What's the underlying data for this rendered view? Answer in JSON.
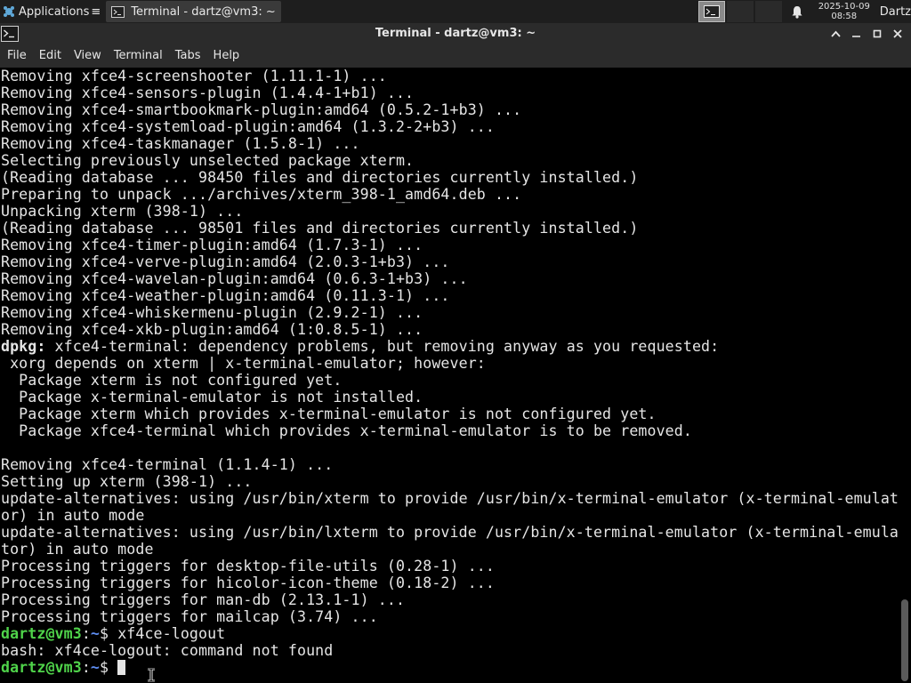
{
  "panel": {
    "apps_label": "Applications",
    "task_label": "Terminal - dartz@vm3: ~",
    "clock_date": "2025-10-09",
    "clock_time": "08:58",
    "user": "Dartz"
  },
  "window": {
    "title": "Terminal - dartz@vm3: ~"
  },
  "menu": [
    "File",
    "Edit",
    "View",
    "Terminal",
    "Tabs",
    "Help"
  ],
  "terminal": {
    "lines": [
      {
        "text": "Removing xfce4-screenshooter (1.11.1-1) ..."
      },
      {
        "text": "Removing xfce4-sensors-plugin (1.4.4-1+b1) ..."
      },
      {
        "text": "Removing xfce4-smartbookmark-plugin:amd64 (0.5.2-1+b3) ..."
      },
      {
        "text": "Removing xfce4-systemload-plugin:amd64 (1.3.2-2+b3) ..."
      },
      {
        "text": "Removing xfce4-taskmanager (1.5.8-1) ..."
      },
      {
        "text": "Selecting previously unselected package xterm."
      },
      {
        "text": "(Reading database ... 98450 files and directories currently installed.)"
      },
      {
        "text": "Preparing to unpack .../archives/xterm_398-1_amd64.deb ..."
      },
      {
        "text": "Unpacking xterm (398-1) ..."
      },
      {
        "text": "(Reading database ... 98501 files and directories currently installed.)"
      },
      {
        "text": "Removing xfce4-timer-plugin:amd64 (1.7.3-1) ..."
      },
      {
        "text": "Removing xfce4-verve-plugin:amd64 (2.0.3-1+b3) ..."
      },
      {
        "text": "Removing xfce4-wavelan-plugin:amd64 (0.6.3-1+b3) ..."
      },
      {
        "text": "Removing xfce4-weather-plugin:amd64 (0.11.3-1) ..."
      },
      {
        "text": "Removing xfce4-whiskermenu-plugin (2.9.2-1) ..."
      },
      {
        "text": "Removing xfce4-xkb-plugin:amd64 (1:0.8.5-1) ..."
      },
      {
        "bold": "dpkg:",
        "text": " xfce4-terminal: dependency problems, but removing anyway as you requested:"
      },
      {
        "text": " xorg depends on xterm | x-terminal-emulator; however:"
      },
      {
        "text": "  Package xterm is not configured yet."
      },
      {
        "text": "  Package x-terminal-emulator is not installed."
      },
      {
        "text": "  Package xterm which provides x-terminal-emulator is not configured yet."
      },
      {
        "text": "  Package xfce4-terminal which provides x-terminal-emulator is to be removed."
      },
      {
        "text": ""
      },
      {
        "text": "Removing xfce4-terminal (1.1.4-1) ..."
      },
      {
        "text": "Setting up xterm (398-1) ..."
      },
      {
        "text": "update-alternatives: using /usr/bin/xterm to provide /usr/bin/x-terminal-emulator (x-terminal-emulat"
      },
      {
        "text": "or) in auto mode"
      },
      {
        "text": "update-alternatives: using /usr/bin/lxterm to provide /usr/bin/x-terminal-emulator (x-terminal-emula"
      },
      {
        "text": "tor) in auto mode"
      },
      {
        "text": "Processing triggers for desktop-file-utils (0.28-1) ..."
      },
      {
        "text": "Processing triggers for hicolor-icon-theme (0.18-2) ..."
      },
      {
        "text": "Processing triggers for man-db (2.13.1-1) ..."
      },
      {
        "text": "Processing triggers for mailcap (3.74) ..."
      },
      {
        "prompt_user": "dartz@vm3",
        "prompt_sep": ":",
        "prompt_path": "~",
        "prompt_sign": "$ ",
        "text": "xf4ce-logout"
      },
      {
        "text": "bash: xf4ce-logout: command not found"
      },
      {
        "prompt_user": "dartz@vm3",
        "prompt_sep": ":",
        "prompt_path": "~",
        "prompt_sign": "$ ",
        "text": "",
        "cursor": true
      }
    ]
  }
}
